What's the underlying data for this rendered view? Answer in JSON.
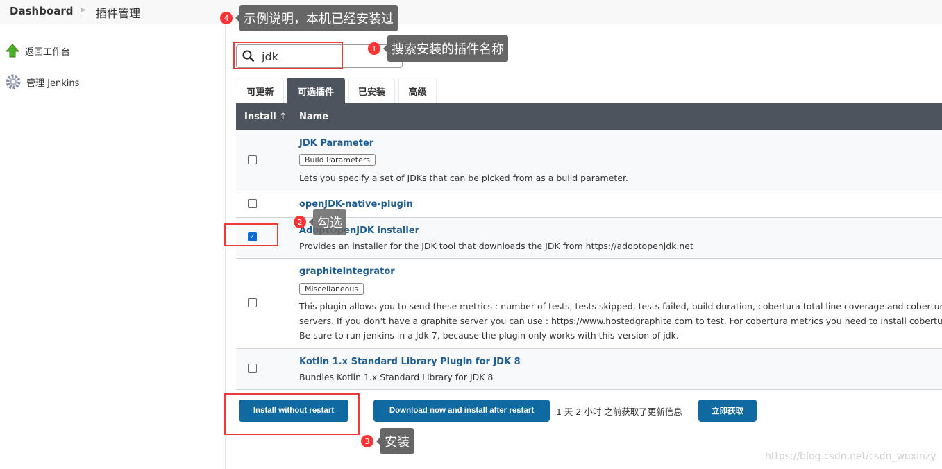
{
  "breadcrumb": {
    "root": "Dashboard",
    "current": "插件管理"
  },
  "sidebar": {
    "items": [
      {
        "label": "返回工作台",
        "icon": "up-arrow-icon"
      },
      {
        "label": "管理 Jenkins",
        "icon": "gear-icon"
      }
    ]
  },
  "search": {
    "value": "jdk"
  },
  "tabs": [
    {
      "label": "可更新"
    },
    {
      "label": "可选插件",
      "active": true
    },
    {
      "label": "已安装"
    },
    {
      "label": "高级"
    }
  ],
  "table": {
    "headers": {
      "install": "Install ↑",
      "name": "Name"
    },
    "rows": [
      {
        "name": "JDK Parameter",
        "tag": "Build Parameters",
        "desc": [
          "Lets you specify a set of JDKs that can be picked from as a build parameter."
        ],
        "checked": false
      },
      {
        "name": "openJDK-native-plugin",
        "checked": false
      },
      {
        "name": "AdoptOpenJDK installer",
        "desc": [
          "Provides an installer for the JDK tool that downloads the JDK from https://adoptopenjdk.net"
        ],
        "checked": true
      },
      {
        "name": "graphiteIntegrator",
        "tag": "Miscellaneous",
        "desc": [
          "This plugin allows you to send these metrics : number of tests, tests skipped, tests failed, build duration, cobertura total line coverage and cobertura to",
          "servers. If you don't have a graphite server you can use : https://www.hostedgraphite.com to test. For cobertura metrics you need to install cobertura p",
          "Be sure to run jenkins in a Jdk 7, because the plugin only works with this version of jdk."
        ],
        "checked": false
      },
      {
        "name": "Kotlin 1.x Standard Library Plugin for JDK 8",
        "desc": [
          "Bundles Kotlin 1.x Standard Library for JDK 8"
        ],
        "checked": false
      }
    ]
  },
  "actions": {
    "install_now": "Install without restart",
    "install_later": "Download now and install after restart",
    "update_info": "1 天 2 小时 之前获取了更新信息",
    "fetch_now": "立即获取"
  },
  "annotations": [
    {
      "num": "1",
      "text": "搜索安装的插件名称"
    },
    {
      "num": "2",
      "text": "勾选"
    },
    {
      "num": "3",
      "text": "安装"
    },
    {
      "num": "4",
      "text": "示例说明，本机已经安装过"
    }
  ],
  "watermark": "https://blog.csdn.net/csdn_wuxinzy",
  "colors": {
    "header_dark": "#4d545d",
    "button": "#0f6aa2",
    "link": "#1f5e93",
    "annotation_red": "#f03a3a"
  }
}
